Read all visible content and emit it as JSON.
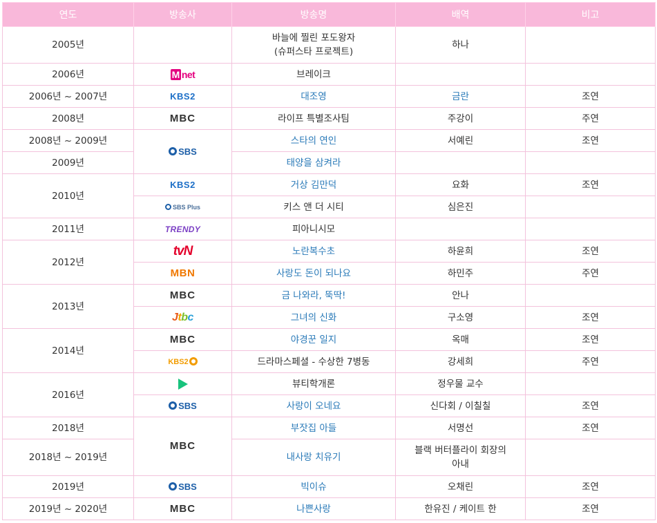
{
  "header": {
    "year": "연도",
    "broadcaster": "방송사",
    "title": "방송명",
    "role": "배역",
    "note": "비고"
  },
  "logos": {
    "mnet": {
      "m": "M",
      "text": "net",
      "icon": "mnet-logo",
      "color": "#e4007f"
    },
    "kbs2": {
      "text": "KBS2",
      "icon": "kbs2-logo",
      "color": "#1d6fc7"
    },
    "mbc": {
      "text": "MBC",
      "icon": "mbc-logo",
      "color": "#333333"
    },
    "sbs": {
      "text": "SBS",
      "icon": "sbs-logo",
      "color": "#1d5fa8"
    },
    "sbsplus": {
      "text": "SBS Plus",
      "icon": "sbs-plus-logo"
    },
    "trendy": {
      "text": "TRENDY",
      "icon": "trendy-logo",
      "color": "#7b3fc4"
    },
    "tvn": {
      "text": "tvN",
      "icon": "tvn-logo",
      "color": "#e4002b"
    },
    "mbn": {
      "text": "MBN",
      "icon": "mbn-logo",
      "color": "#f07800"
    },
    "jtbc": {
      "j": "J",
      "t": "t",
      "b": "b",
      "c": "c",
      "icon": "jtbc-logo"
    },
    "kbs2tv": {
      "text": "KBS2",
      "icon": "kbs2-drama-logo",
      "color": "#f29c00"
    },
    "naver": {
      "icon": "naver-tv-play-logo",
      "color": "#19c37d"
    }
  },
  "rows": [
    {
      "year": "2005년",
      "title_line1": "바늘에 찔린 포도왕자",
      "title_line2": "(슈퍼스타 프로젝트)",
      "role": "하나",
      "note": ""
    },
    {
      "year": "2006년",
      "title": "브레이크",
      "role": "",
      "note": ""
    },
    {
      "year": "2006년 ~ 2007년",
      "title": "대조영",
      "role": "금란",
      "note": "조연"
    },
    {
      "year": "2008년",
      "title": "라이프 특별조사팀",
      "role": "주강이",
      "note": "주연"
    },
    {
      "year": "2008년 ~ 2009년",
      "title": "스타의 연인",
      "role": "서예린",
      "note": "조연"
    },
    {
      "year": "2009년",
      "title": "태양을 삼켜라",
      "role": "",
      "note": ""
    },
    {
      "year": "2010년",
      "title": "거상 김만덕",
      "role": "요화",
      "note": "조연"
    },
    {
      "title": "키스 앤 더 시티",
      "role": "심은진",
      "note": ""
    },
    {
      "year": "2011년",
      "title": "피아니시모",
      "role": "",
      "note": ""
    },
    {
      "year": "2012년",
      "title": "노란복수초",
      "role": "하윤희",
      "note": "조연"
    },
    {
      "title": "사랑도 돈이 되나요",
      "role": "하민주",
      "note": "주연"
    },
    {
      "year": "2013년",
      "title": "금 나와라, 뚝딱!",
      "role": "안나",
      "note": ""
    },
    {
      "title": "그녀의 신화",
      "role": "구소영",
      "note": "조연"
    },
    {
      "year": "2014년",
      "title": "야경꾼 일지",
      "role": "옥매",
      "note": "조연"
    },
    {
      "title": "드라마스페셜 - 수상한 7병동",
      "role": "강세희",
      "note": "주연"
    },
    {
      "year": "2016년",
      "title": "뷰티학개론",
      "role": "정우물 교수",
      "note": ""
    },
    {
      "title": "사랑이 오네요",
      "role": "신다회 / 이칠칠",
      "note": "조연"
    },
    {
      "year": "2018년",
      "title": "부잣집 아들",
      "role": "서명선",
      "note": "조연"
    },
    {
      "year": "2018년 ~ 2019년",
      "title": "내사랑 치유기",
      "role_line1": "블랙 버터플라이 회장의",
      "role_line2": "아내",
      "note": ""
    },
    {
      "year": "2019년",
      "title": "빅이슈",
      "role": "오채린",
      "note": "조연"
    },
    {
      "year": "2019년 ~ 2020년",
      "title": "나쁜사랑",
      "role": "한유진 / 케이트 한",
      "note": "조연"
    }
  ]
}
